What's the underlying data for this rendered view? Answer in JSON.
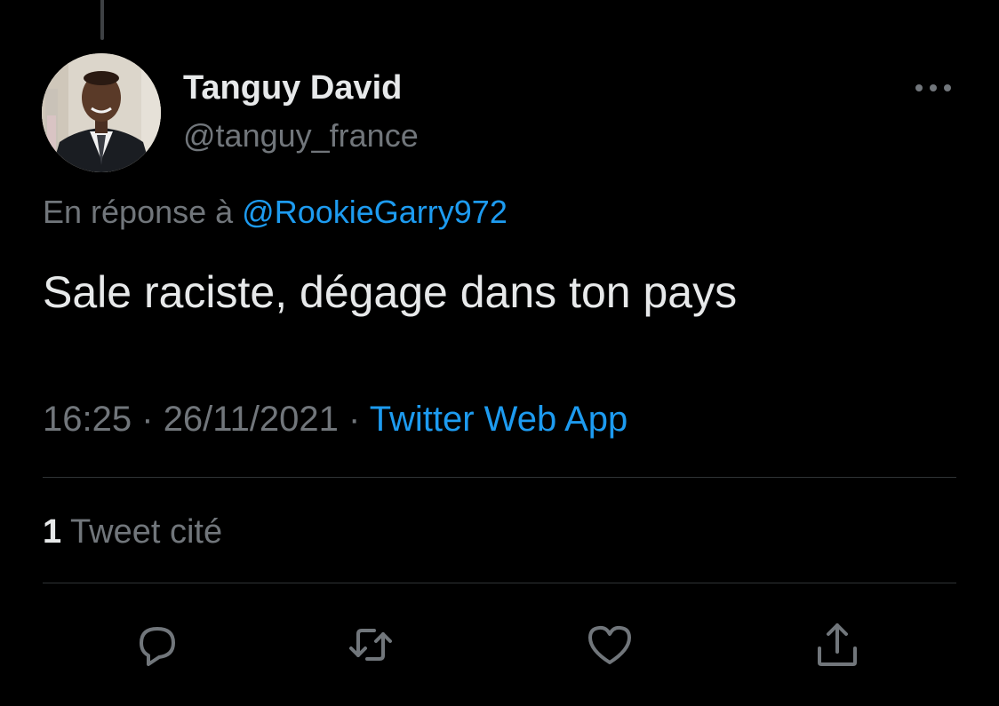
{
  "tweet": {
    "author": {
      "display_name": "Tanguy David",
      "handle": "@tanguy_france",
      "avatar_icon": "profile-photo"
    },
    "reply": {
      "prefix": "En réponse à",
      "mention": "@RookieGarry972"
    },
    "text": "Sale raciste, dégage dans ton pays",
    "meta": {
      "time": "16:25",
      "separator": "·",
      "date": "26/11/2021",
      "source": "Twitter Web App"
    },
    "stats": {
      "quote_count": "1",
      "quote_label": "Tweet cité"
    },
    "actions": [
      {
        "icon": "reply-icon"
      },
      {
        "icon": "retweet-icon"
      },
      {
        "icon": "like-icon"
      },
      {
        "icon": "share-icon"
      }
    ],
    "more_icon": "more-icon"
  },
  "colors": {
    "background": "#000000",
    "text_primary": "#e7e9ea",
    "text_secondary": "#71767b",
    "accent": "#1d9bf0",
    "divider": "#2f3336"
  }
}
